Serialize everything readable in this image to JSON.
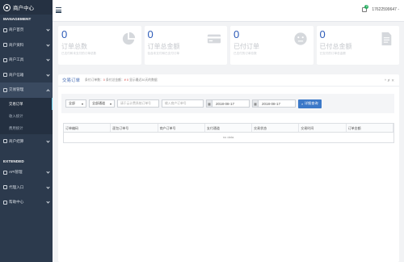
{
  "brand": {
    "title": "商户中心"
  },
  "sections": {
    "management": "MANAGEMENT",
    "extended": "EXTENDED"
  },
  "nav": {
    "home": "商户首页",
    "profile": "商户资料",
    "tools": "商户工具",
    "messages": "商户信箱",
    "orders": "交易管理",
    "submenu": [
      "交易订单",
      "收入统计",
      "费用统计"
    ],
    "settlement": "商户结算",
    "api": "API管理",
    "proxy": "代理入口",
    "help": "帮助中心"
  },
  "topbar": {
    "user": "17622599647 -",
    "badge": "0"
  },
  "stats": [
    {
      "value": "0",
      "label": "订单总数",
      "note": "已支付和未支付的订单总数"
    },
    {
      "value": "0",
      "label": "订单总金额",
      "note": "包含未支付和已支付订单"
    },
    {
      "value": "0",
      "label": "已付订单",
      "note": "已支付的订单总数"
    },
    {
      "value": "0",
      "label": "已付总金额",
      "note": "已支付的订单总金额"
    }
  ],
  "panel": {
    "title": "交易订单",
    "summary_prefix": "条付订单数：",
    "summary_count": "0",
    "summary_mid": " 条付总金额：",
    "summary_amount": "¥ 0",
    "summary_suffix": " 显示最近30天的数据",
    "tools": "^ ✗ ✕"
  },
  "filter": {
    "status": "全部",
    "channel": "全部通道",
    "order_placeholder": "请于云计费系统订单号",
    "merchant_placeholder": "输入商户订单号",
    "date_start": "2018-08-17",
    "date_end": "2018-08-17",
    "search": "详细查询"
  },
  "table": {
    "columns": [
      "订单编码",
      "面包订单号",
      "商户订单号",
      "支付通道",
      "交易状态",
      "交易时间",
      "订单金额"
    ],
    "empty": "no data."
  }
}
